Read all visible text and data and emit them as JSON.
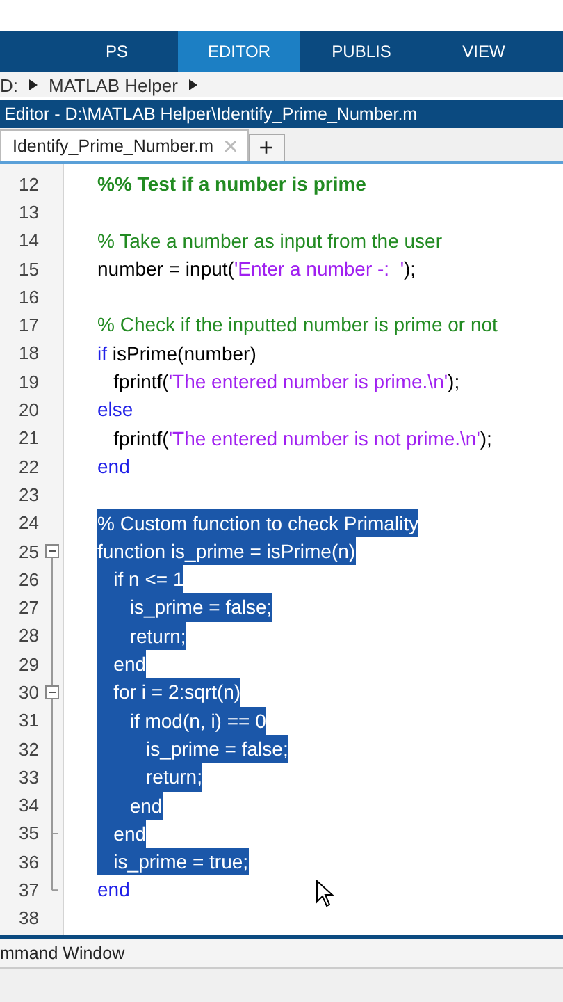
{
  "toolstrip": {
    "tabs": [
      {
        "label": "PS",
        "selected": false
      },
      {
        "label": "EDITOR",
        "selected": true
      },
      {
        "label": "PUBLIS",
        "selected": false
      },
      {
        "label": "VIEW",
        "selected": false
      }
    ]
  },
  "path_bar": {
    "parts": [
      "D:",
      "MATLAB Helper"
    ]
  },
  "editor": {
    "title": "Editor - D:\\MATLAB Helper\\Identify_Prime_Number.m",
    "tabs": [
      {
        "label": "Identify_Prime_Number.m",
        "selected": true
      }
    ],
    "new_tab": "+",
    "lines": [
      {
        "number": "12",
        "fold_start": false,
        "fold_end": false,
        "selected": false,
        "segments": [
          {
            "t": "%% Test if a number is prime",
            "kind": "section"
          }
        ]
      },
      {
        "number": "13",
        "fold_start": false,
        "fold_end": false,
        "selected": false
      },
      {
        "number": "14",
        "fold_start": false,
        "fold_end": false,
        "selected": false,
        "segments": [
          {
            "t": "% Take a number as input from the user",
            "kind": "comment"
          }
        ]
      },
      {
        "number": "15",
        "fold_start": false,
        "fold_end": false,
        "selected": false,
        "segments": [
          {
            "t": "number = input(",
            "kind": "plain"
          },
          {
            "t": "'Enter a number -:  '",
            "kind": "string"
          },
          {
            "t": ");",
            "kind": "plain"
          }
        ]
      },
      {
        "number": "16",
        "fold_start": false,
        "fold_end": false,
        "selected": false
      },
      {
        "number": "17",
        "fold_start": false,
        "fold_end": false,
        "selected": false,
        "segments": [
          {
            "t": "% Check if the inputted number is prime or not",
            "kind": "comment"
          }
        ]
      },
      {
        "number": "18",
        "fold_start": false,
        "fold_end": false,
        "selected": false,
        "segments": [
          {
            "t": "if",
            "kind": "keyword"
          },
          {
            "t": " isPrime(number)",
            "kind": "plain"
          }
        ]
      },
      {
        "number": "19",
        "fold_start": false,
        "fold_end": false,
        "selected": false,
        "segments": [
          {
            "t": "   fprintf(",
            "kind": "plain"
          },
          {
            "t": "'The entered number is prime.\\n'",
            "kind": "string"
          },
          {
            "t": ");",
            "kind": "plain"
          }
        ]
      },
      {
        "number": "20",
        "fold_start": false,
        "fold_end": false,
        "selected": false,
        "segments": [
          {
            "t": "else",
            "kind": "keyword"
          }
        ]
      },
      {
        "number": "21",
        "fold_start": false,
        "fold_end": false,
        "selected": false,
        "segments": [
          {
            "t": "   fprintf(",
            "kind": "plain"
          },
          {
            "t": "'The entered number is not prime.\\n'",
            "kind": "string"
          },
          {
            "t": ");",
            "kind": "plain"
          }
        ]
      },
      {
        "number": "22",
        "fold_start": false,
        "fold_end": false,
        "selected": false,
        "segments": [
          {
            "t": "end",
            "kind": "keyword"
          }
        ]
      },
      {
        "number": "23",
        "fold_start": false,
        "fold_end": false,
        "selected": false
      },
      {
        "number": "24",
        "fold_start": false,
        "fold_end": false,
        "selected": true,
        "segments": [
          {
            "t": "% Custom function to check Primality",
            "kind": "comment"
          }
        ]
      },
      {
        "number": "25",
        "fold_start": true,
        "fold_end": false,
        "selected": true,
        "segments": [
          {
            "t": "function",
            "kind": "keyword"
          },
          {
            "t": " is_prime = isPrime(n)",
            "kind": "plain"
          }
        ]
      },
      {
        "number": "26",
        "fold_start": false,
        "fold_end": false,
        "selected": true,
        "segments": [
          {
            "t": "   if",
            "kind": "keyword"
          },
          {
            "t": " n <= 1",
            "kind": "plain"
          }
        ]
      },
      {
        "number": "27",
        "fold_start": false,
        "fold_end": false,
        "selected": true,
        "segments": [
          {
            "t": "      is_prime = false;",
            "kind": "plain"
          }
        ]
      },
      {
        "number": "28",
        "fold_start": false,
        "fold_end": false,
        "selected": true,
        "segments": [
          {
            "t": "      return;",
            "kind": "keyword"
          }
        ]
      },
      {
        "number": "29",
        "fold_start": false,
        "fold_end": false,
        "selected": true,
        "segments": [
          {
            "t": "   end",
            "kind": "keyword"
          }
        ]
      },
      {
        "number": "30",
        "fold_start": true,
        "fold_end": false,
        "selected": true,
        "segments": [
          {
            "t": "   for",
            "kind": "keyword"
          },
          {
            "t": " i = 2:sqrt(n)",
            "kind": "plain"
          }
        ]
      },
      {
        "number": "31",
        "fold_start": false,
        "fold_end": false,
        "selected": true,
        "segments": [
          {
            "t": "      if",
            "kind": "keyword"
          },
          {
            "t": " mod(n, i) == 0",
            "kind": "plain"
          }
        ]
      },
      {
        "number": "32",
        "fold_start": false,
        "fold_end": false,
        "selected": true,
        "segments": [
          {
            "t": "         is_prime = false;",
            "kind": "plain"
          }
        ]
      },
      {
        "number": "33",
        "fold_start": false,
        "fold_end": false,
        "selected": true,
        "segments": [
          {
            "t": "         return;",
            "kind": "keyword"
          }
        ]
      },
      {
        "number": "34",
        "fold_start": false,
        "fold_end": false,
        "selected": true,
        "segments": [
          {
            "t": "      end",
            "kind": "keyword"
          }
        ]
      },
      {
        "number": "35",
        "fold_start": false,
        "fold_end": true,
        "selected": true,
        "segments": [
          {
            "t": "   end",
            "kind": "keyword"
          }
        ]
      },
      {
        "number": "36",
        "fold_start": false,
        "fold_end": false,
        "selected": true,
        "segments": [
          {
            "t": "   is_prime = true;",
            "kind": "plain"
          }
        ]
      },
      {
        "number": "37",
        "fold_start": false,
        "fold_end": true,
        "selected": false,
        "segments": [
          {
            "t": "end",
            "kind": "keyword"
          }
        ]
      },
      {
        "number": "38",
        "fold_start": false,
        "fold_end": false,
        "selected": false
      }
    ]
  },
  "command_window": {
    "title": "mmand Window"
  }
}
